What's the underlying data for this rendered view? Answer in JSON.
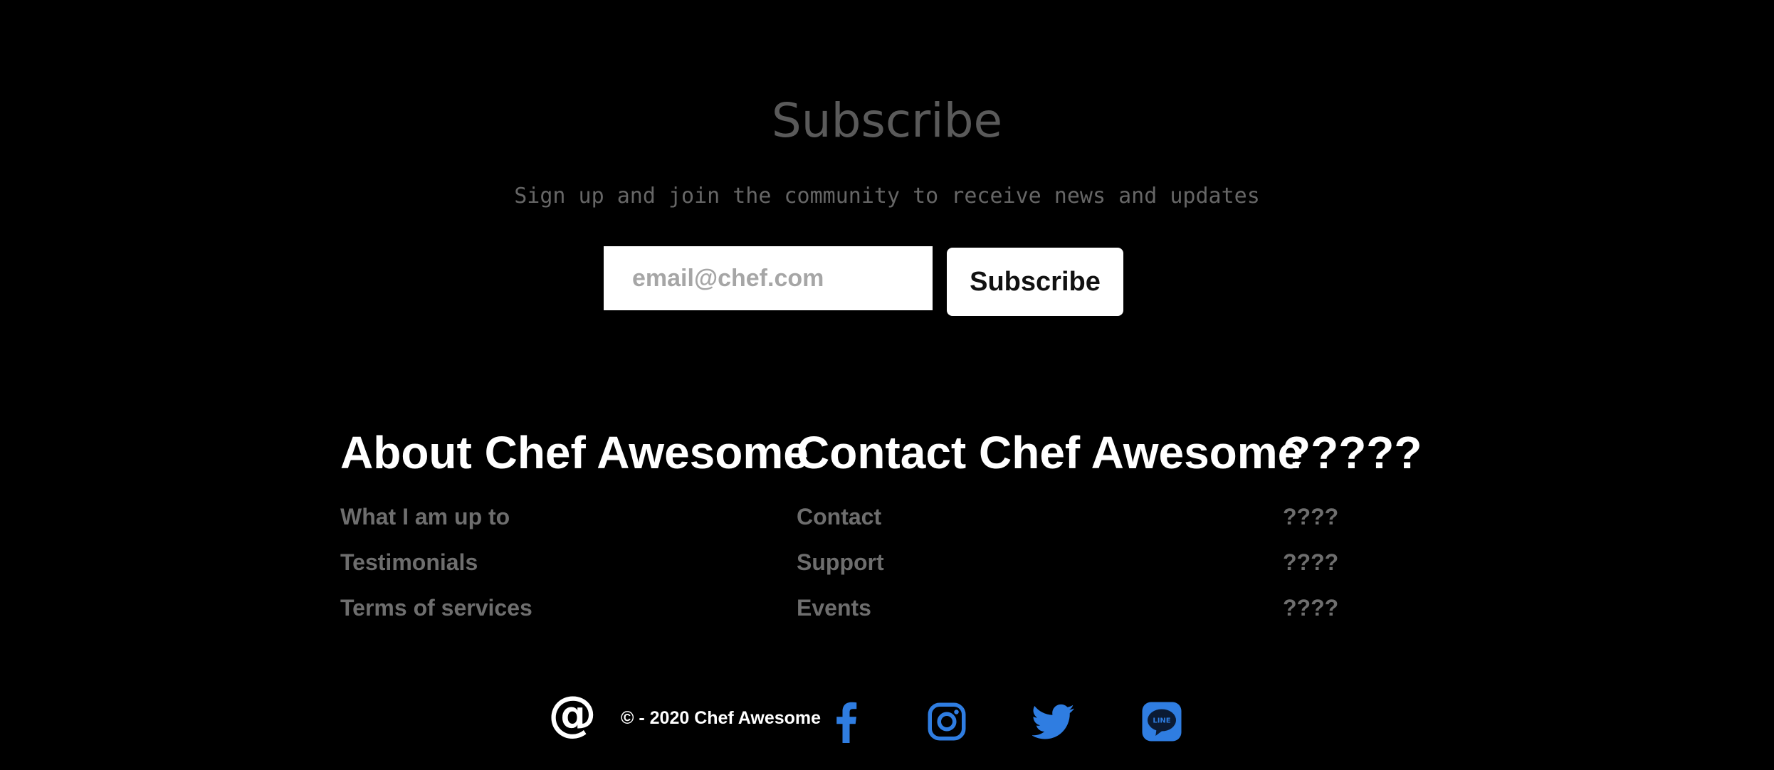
{
  "subscribe": {
    "title": "Subscribe",
    "description": "Sign up and join the community to receive news and updates",
    "email_placeholder": "email@chef.com",
    "button_label": "Subscribe"
  },
  "columns": [
    {
      "heading": "About Chef Awesome",
      "links": [
        "What I am up to",
        "Testimonials",
        "Terms of services"
      ]
    },
    {
      "heading": "Contact Chef Awesome",
      "links": [
        "Contact",
        "Support",
        "Events"
      ]
    },
    {
      "heading": "?????",
      "links": [
        "????",
        "????",
        "????"
      ]
    }
  ],
  "footer": {
    "at_symbol": "@",
    "copyright": "© - 2020 Chef Awesome",
    "social_icons": [
      "facebook-icon",
      "instagram-icon",
      "twitter-icon",
      "line-icon"
    ],
    "social_color": "#2f7de1",
    "line_badge_text": "LINE"
  },
  "colors": {
    "background": "#000000",
    "title_gray": "#5a5a5a",
    "link_gray": "#6e6e6e",
    "accent_blue": "#2f7de1"
  }
}
